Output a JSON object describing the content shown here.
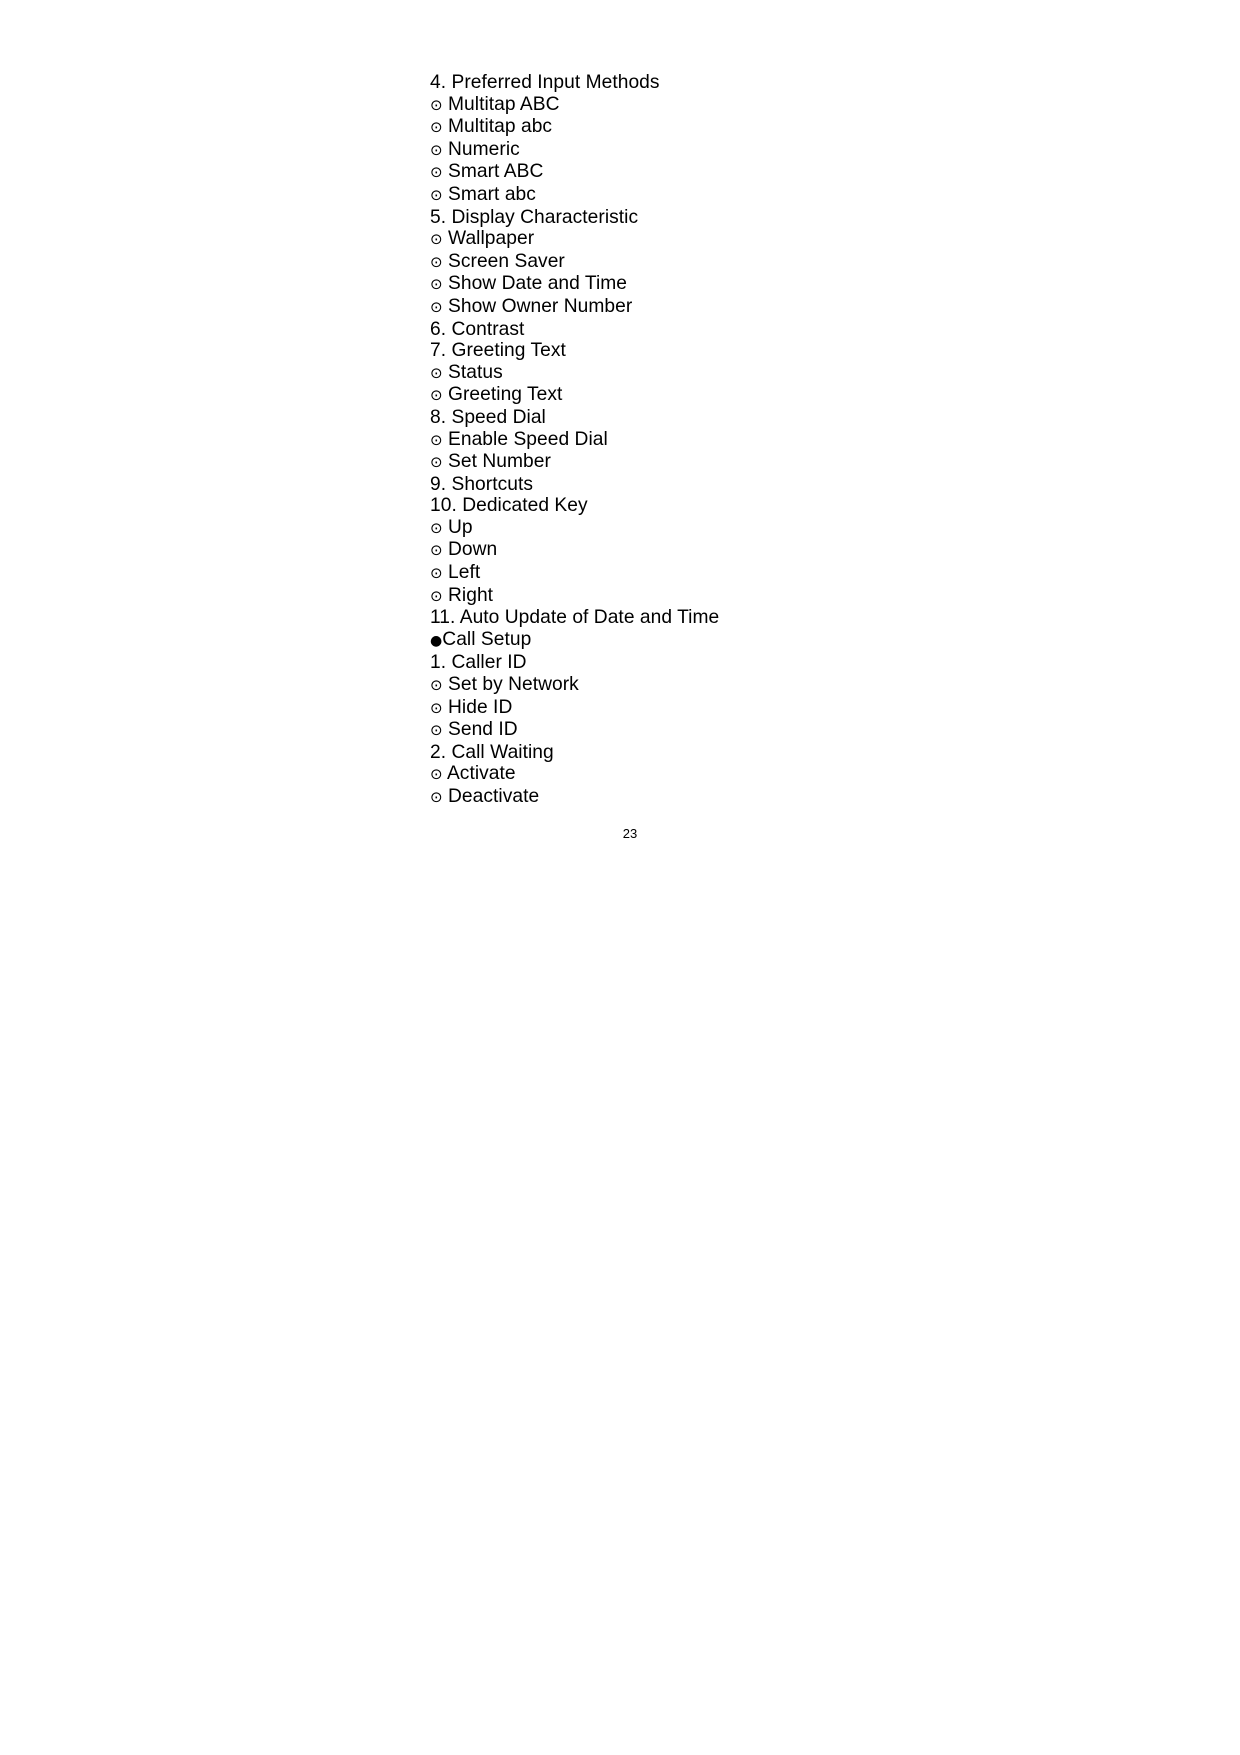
{
  "document": {
    "page_number": "23",
    "markers": {
      "dot_circle": "⊙",
      "filled": "●"
    },
    "lines": [
      {
        "marker": "none",
        "text": "4. Preferred Input Methods"
      },
      {
        "marker": "dot_circle",
        "text": "Multitap ABC"
      },
      {
        "marker": "dot_circle",
        "text": "Multitap abc"
      },
      {
        "marker": "dot_circle",
        "text": "Numeric"
      },
      {
        "marker": "dot_circle",
        "text": "Smart ABC"
      },
      {
        "marker": "dot_circle",
        "text": "Smart abc"
      },
      {
        "marker": "none",
        "text": "5. Display Characteristic"
      },
      {
        "marker": "dot_circle",
        "text": "Wallpaper"
      },
      {
        "marker": "dot_circle",
        "text": "Screen Saver"
      },
      {
        "marker": "dot_circle",
        "text": "Show Date and Time"
      },
      {
        "marker": "dot_circle",
        "text": "Show Owner Number"
      },
      {
        "marker": "none",
        "text": "6. Contrast"
      },
      {
        "marker": "none",
        "text": "7. Greeting Text"
      },
      {
        "marker": "dot_circle",
        "text": "Status"
      },
      {
        "marker": "dot_circle",
        "text": "Greeting Text"
      },
      {
        "marker": "none",
        "text": "8. Speed Dial"
      },
      {
        "marker": "dot_circle",
        "text": "Enable Speed Dial"
      },
      {
        "marker": "dot_circle",
        "text": "Set Number"
      },
      {
        "marker": "none",
        "text": "9. Shortcuts"
      },
      {
        "marker": "none",
        "text": "10. Dedicated Key"
      },
      {
        "marker": "dot_circle",
        "text": "Up"
      },
      {
        "marker": "dot_circle",
        "text": "Down"
      },
      {
        "marker": "dot_circle",
        "text": "Left"
      },
      {
        "marker": "dot_circle",
        "text": "Right"
      },
      {
        "marker": "none",
        "text": "11. Auto Update of Date and Time"
      },
      {
        "marker": "filled",
        "text": "Call Setup"
      },
      {
        "marker": "none",
        "text": "1. Caller ID"
      },
      {
        "marker": "dot_circle",
        "text": "Set by Network"
      },
      {
        "marker": "dot_circle",
        "text": "Hide ID"
      },
      {
        "marker": "dot_circle",
        "text": "Send ID"
      },
      {
        "marker": "none",
        "text": "2. Call Waiting"
      },
      {
        "marker": "dot_circle",
        "text": "Activate"
      },
      {
        "marker": "dot_circle",
        "text": "Deactivate"
      }
    ]
  }
}
